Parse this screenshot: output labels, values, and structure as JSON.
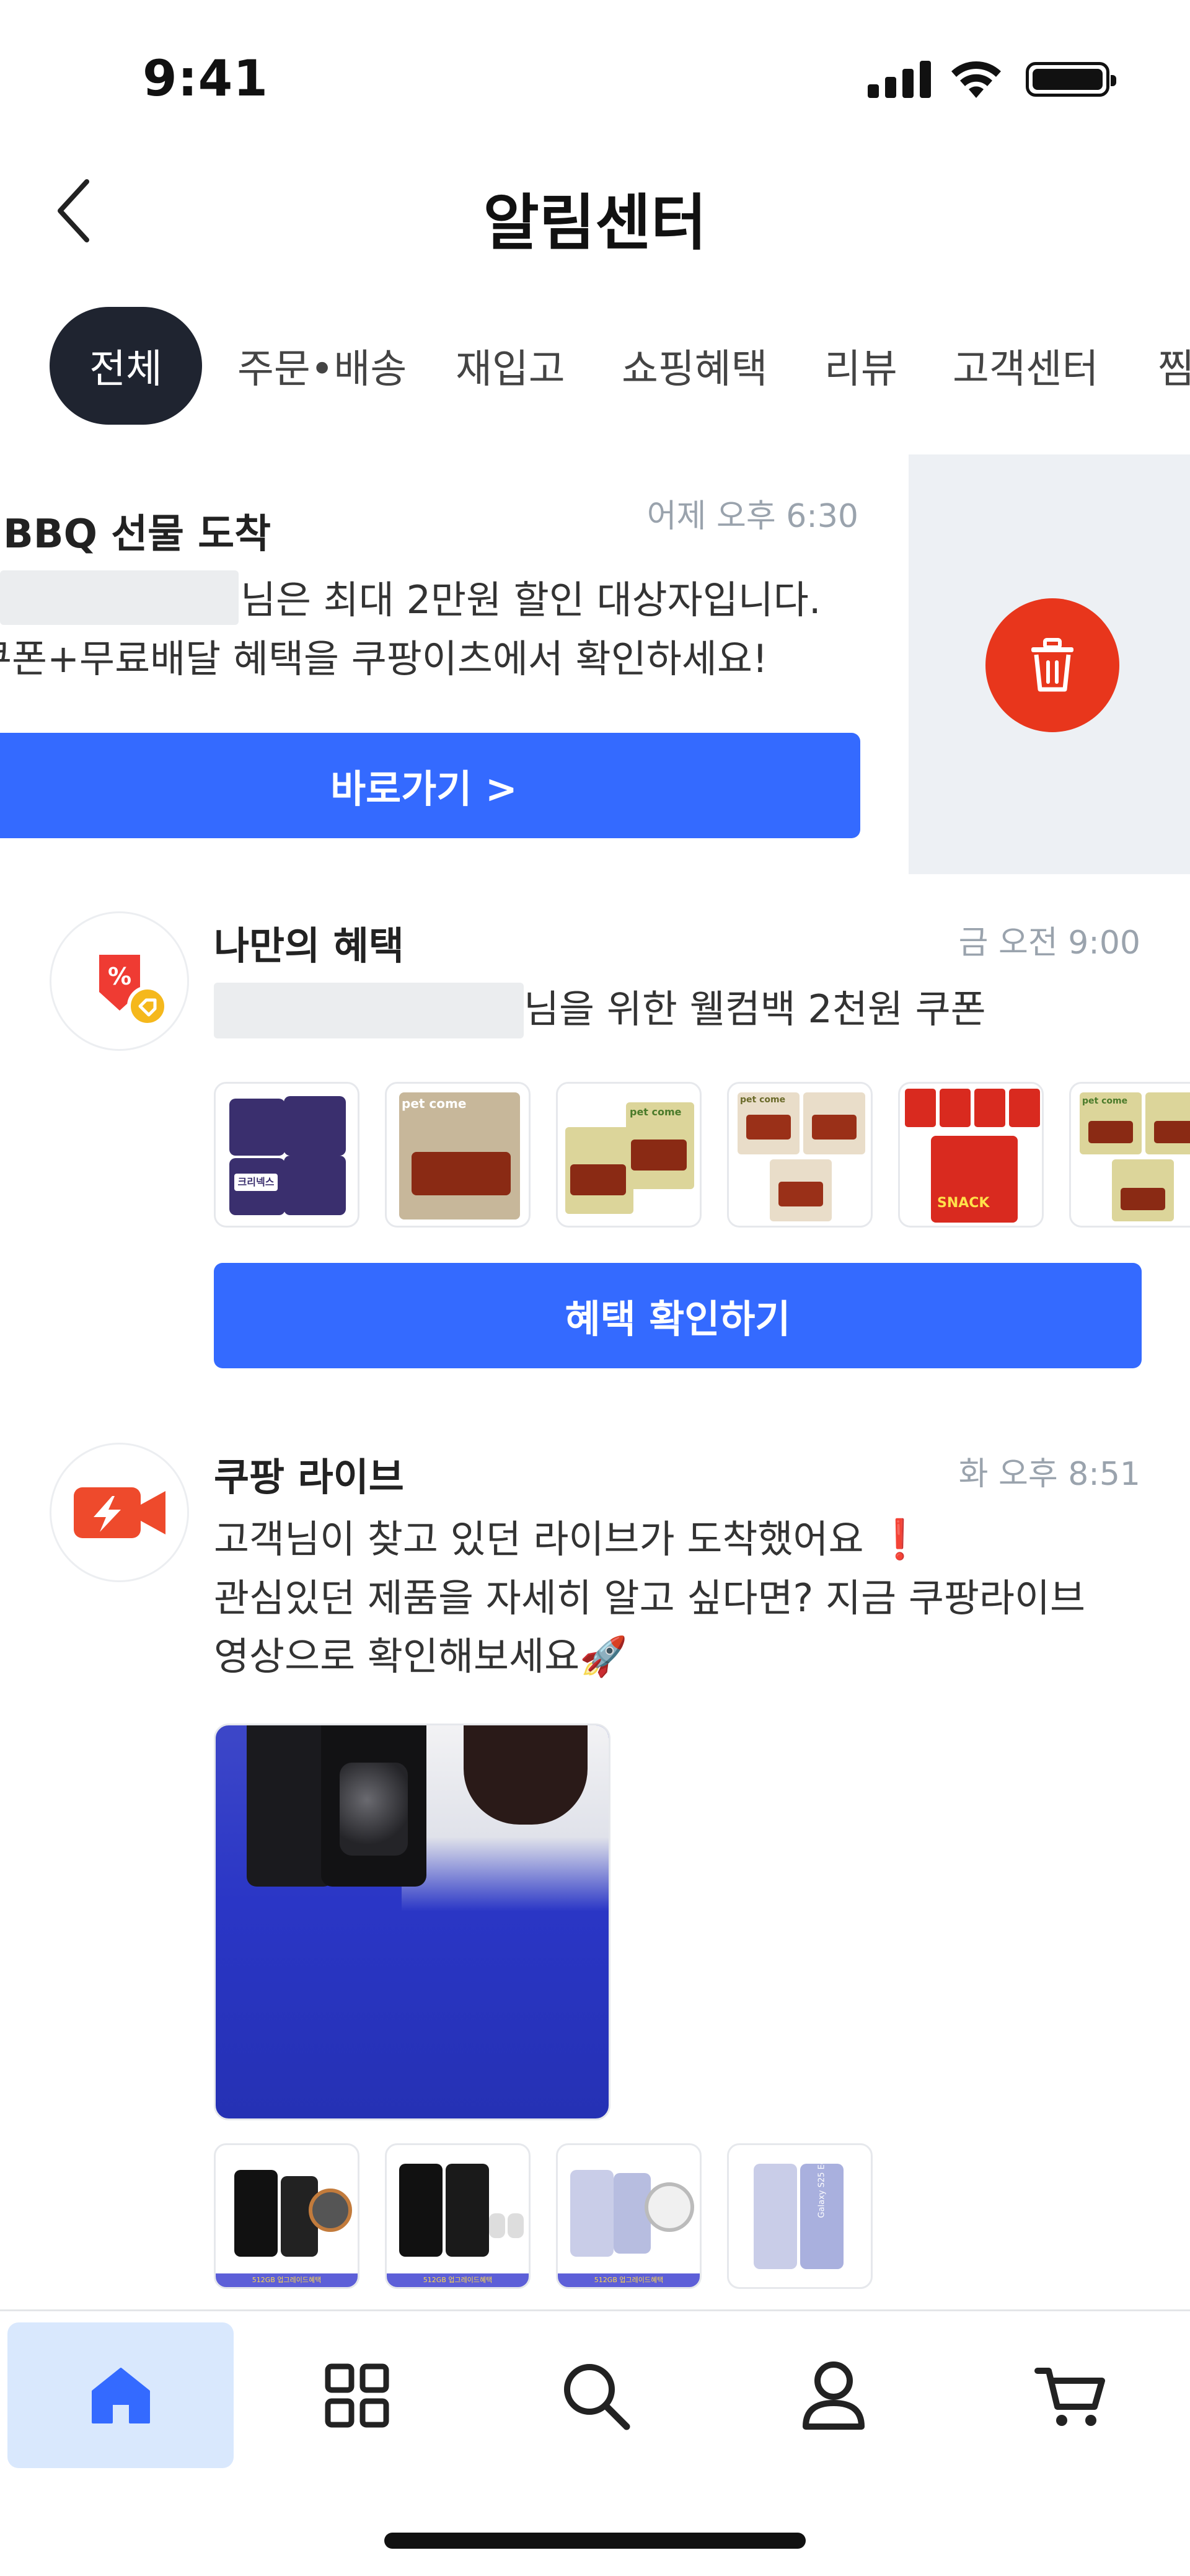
{
  "status_bar": {
    "time": "9:41"
  },
  "header": {
    "title": "알림센터",
    "back_icon": "chevron-left-icon"
  },
  "tabs": [
    {
      "label": "전체",
      "active": true
    },
    {
      "label": "주문•배송",
      "active": false
    },
    {
      "label": "재입고",
      "active": false
    },
    {
      "label": "쇼핑혜택",
      "active": false
    },
    {
      "label": "리뷰",
      "active": false
    },
    {
      "label": "고객센터",
      "active": false
    },
    {
      "label": "찜",
      "active": false
    }
  ],
  "notifications": [
    {
      "title": "BBQ 선물 도착",
      "time": "어제 오후 6:30",
      "line1": "님은 최대 2만원 할인 대상자입니다.",
      "line2": "쿠폰+무료배달 혜택을 쿠팡이츠에서 확인하세요!",
      "cta": "바로가기 >",
      "delete_icon": "trash-icon"
    },
    {
      "title": "나만의 혜택",
      "time": "금 오전 9:00",
      "line1": "님을 위한 웰컴백 2천원 쿠폰",
      "cta": "혜택 확인하기",
      "icon": "coupon-tag-icon"
    },
    {
      "title": "쿠팡 라이브",
      "time": "화 오후 8:51",
      "line1": "고객님이 찾고 있던 라이브가 도착했어요 ❗",
      "line2": "관심있던 제품을 자세히 알고 싶다면? 지금 쿠팡라이브",
      "line3": "영상으로 확인해보세요🚀",
      "icon": "live-video-icon",
      "product_badge": "512GB 업그레이드혜택",
      "product_name": "Galaxy S25 Edge"
    }
  ],
  "product_thumbs_1": [
    "크리넥스",
    "pet come",
    "pet come",
    "pet come",
    "SNACK",
    "pet come"
  ],
  "bottom_nav": [
    {
      "icon": "home-icon",
      "active": true
    },
    {
      "icon": "category-grid-icon",
      "active": false
    },
    {
      "icon": "search-icon",
      "active": false
    },
    {
      "icon": "profile-icon",
      "active": false
    },
    {
      "icon": "cart-icon",
      "active": false
    }
  ],
  "colors": {
    "accent": "#346aff",
    "delete": "#e8361c",
    "active_tab": "#1f2430",
    "nav_active_bg": "#d9e8fd"
  }
}
